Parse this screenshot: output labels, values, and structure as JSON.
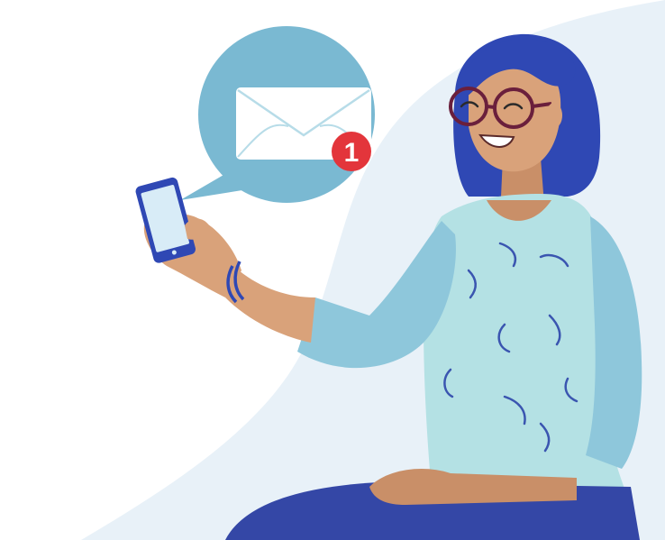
{
  "scene": {
    "description_icon": "envelope-icon",
    "notification": {
      "count": "1"
    },
    "colors": {
      "background_wave": "#e8f1f8",
      "bubble": "#7ab9d2",
      "envelope": "#ffffff",
      "envelope_lines": "#b7dce8",
      "badge": "#e3353b",
      "hair": "#2f48b4",
      "skin": "#d9a27a",
      "glasses": "#6a1f3c",
      "shirt": "#b4e1e4",
      "sleeve": "#8ec7db",
      "pattern": "#3a55b0",
      "pants": "#3447a6",
      "phone_body": "#2f48b4",
      "phone_screen": "#d8ecf7"
    }
  }
}
